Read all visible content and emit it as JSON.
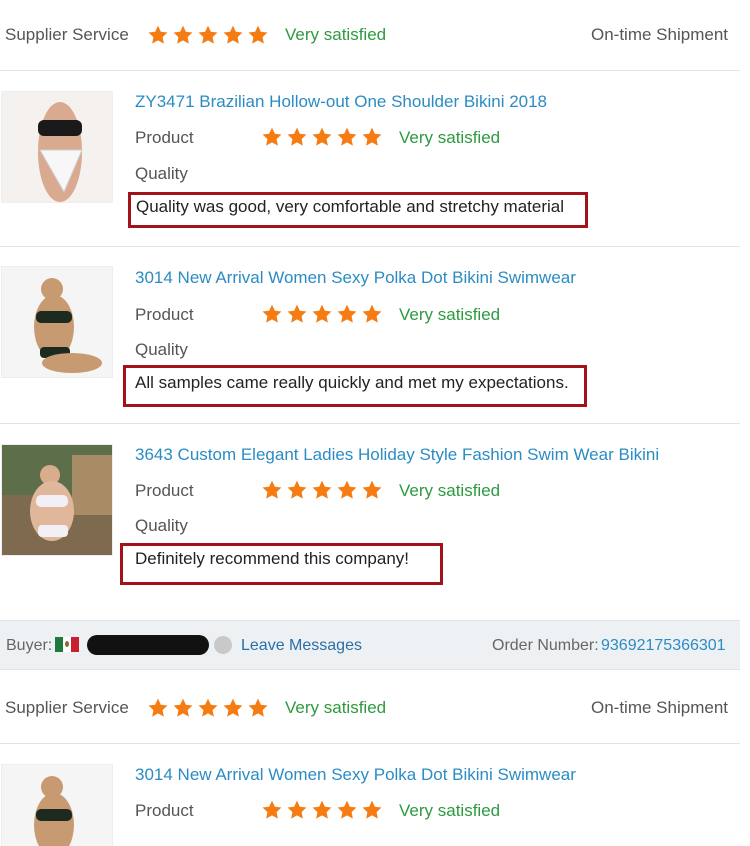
{
  "service_row": {
    "supplier_label": "Supplier Service",
    "rating": "Very satisfied",
    "shipment_label": "On-time Shipment"
  },
  "items": [
    {
      "title": "ZY3471 Brazilian Hollow-out One Shoulder Bikini 2018",
      "product_label": "Product",
      "rating": "Very satisfied",
      "quality_label": "Quality",
      "review": "Quality was good, very comfortable and stretchy material"
    },
    {
      "title": "3014 New Arrival Women Sexy Polka Dot Bikini Swimwear",
      "product_label": "Product",
      "rating": "Very satisfied",
      "quality_label": "Quality",
      "review": "All samples came really quickly and met my expectations."
    },
    {
      "title": "3643 Custom Elegant Ladies Holiday Style Fashion Swim Wear Bikini",
      "product_label": "Product",
      "rating": "Very satisfied",
      "quality_label": "Quality",
      "review": "Definitely recommend this company!"
    }
  ],
  "buyer_bar": {
    "buyer_label": "Buyer:",
    "leave_messages": "Leave Messages",
    "order_label": "Order Number:",
    "order_number": "93692175366301"
  },
  "service_row_2": {
    "supplier_label": "Supplier Service",
    "rating": "Very satisfied",
    "shipment_label": "On-time Shipment"
  },
  "item_4": {
    "title": "3014 New Arrival Women Sexy Polka Dot Bikini Swimwear",
    "product_label": "Product",
    "rating": "Very satisfied"
  },
  "colors": {
    "star": "#f57c13",
    "satisfied": "#2e9a3e",
    "link": "#2b8cc4",
    "highlight_box": "#a11219"
  },
  "star_count": 5
}
